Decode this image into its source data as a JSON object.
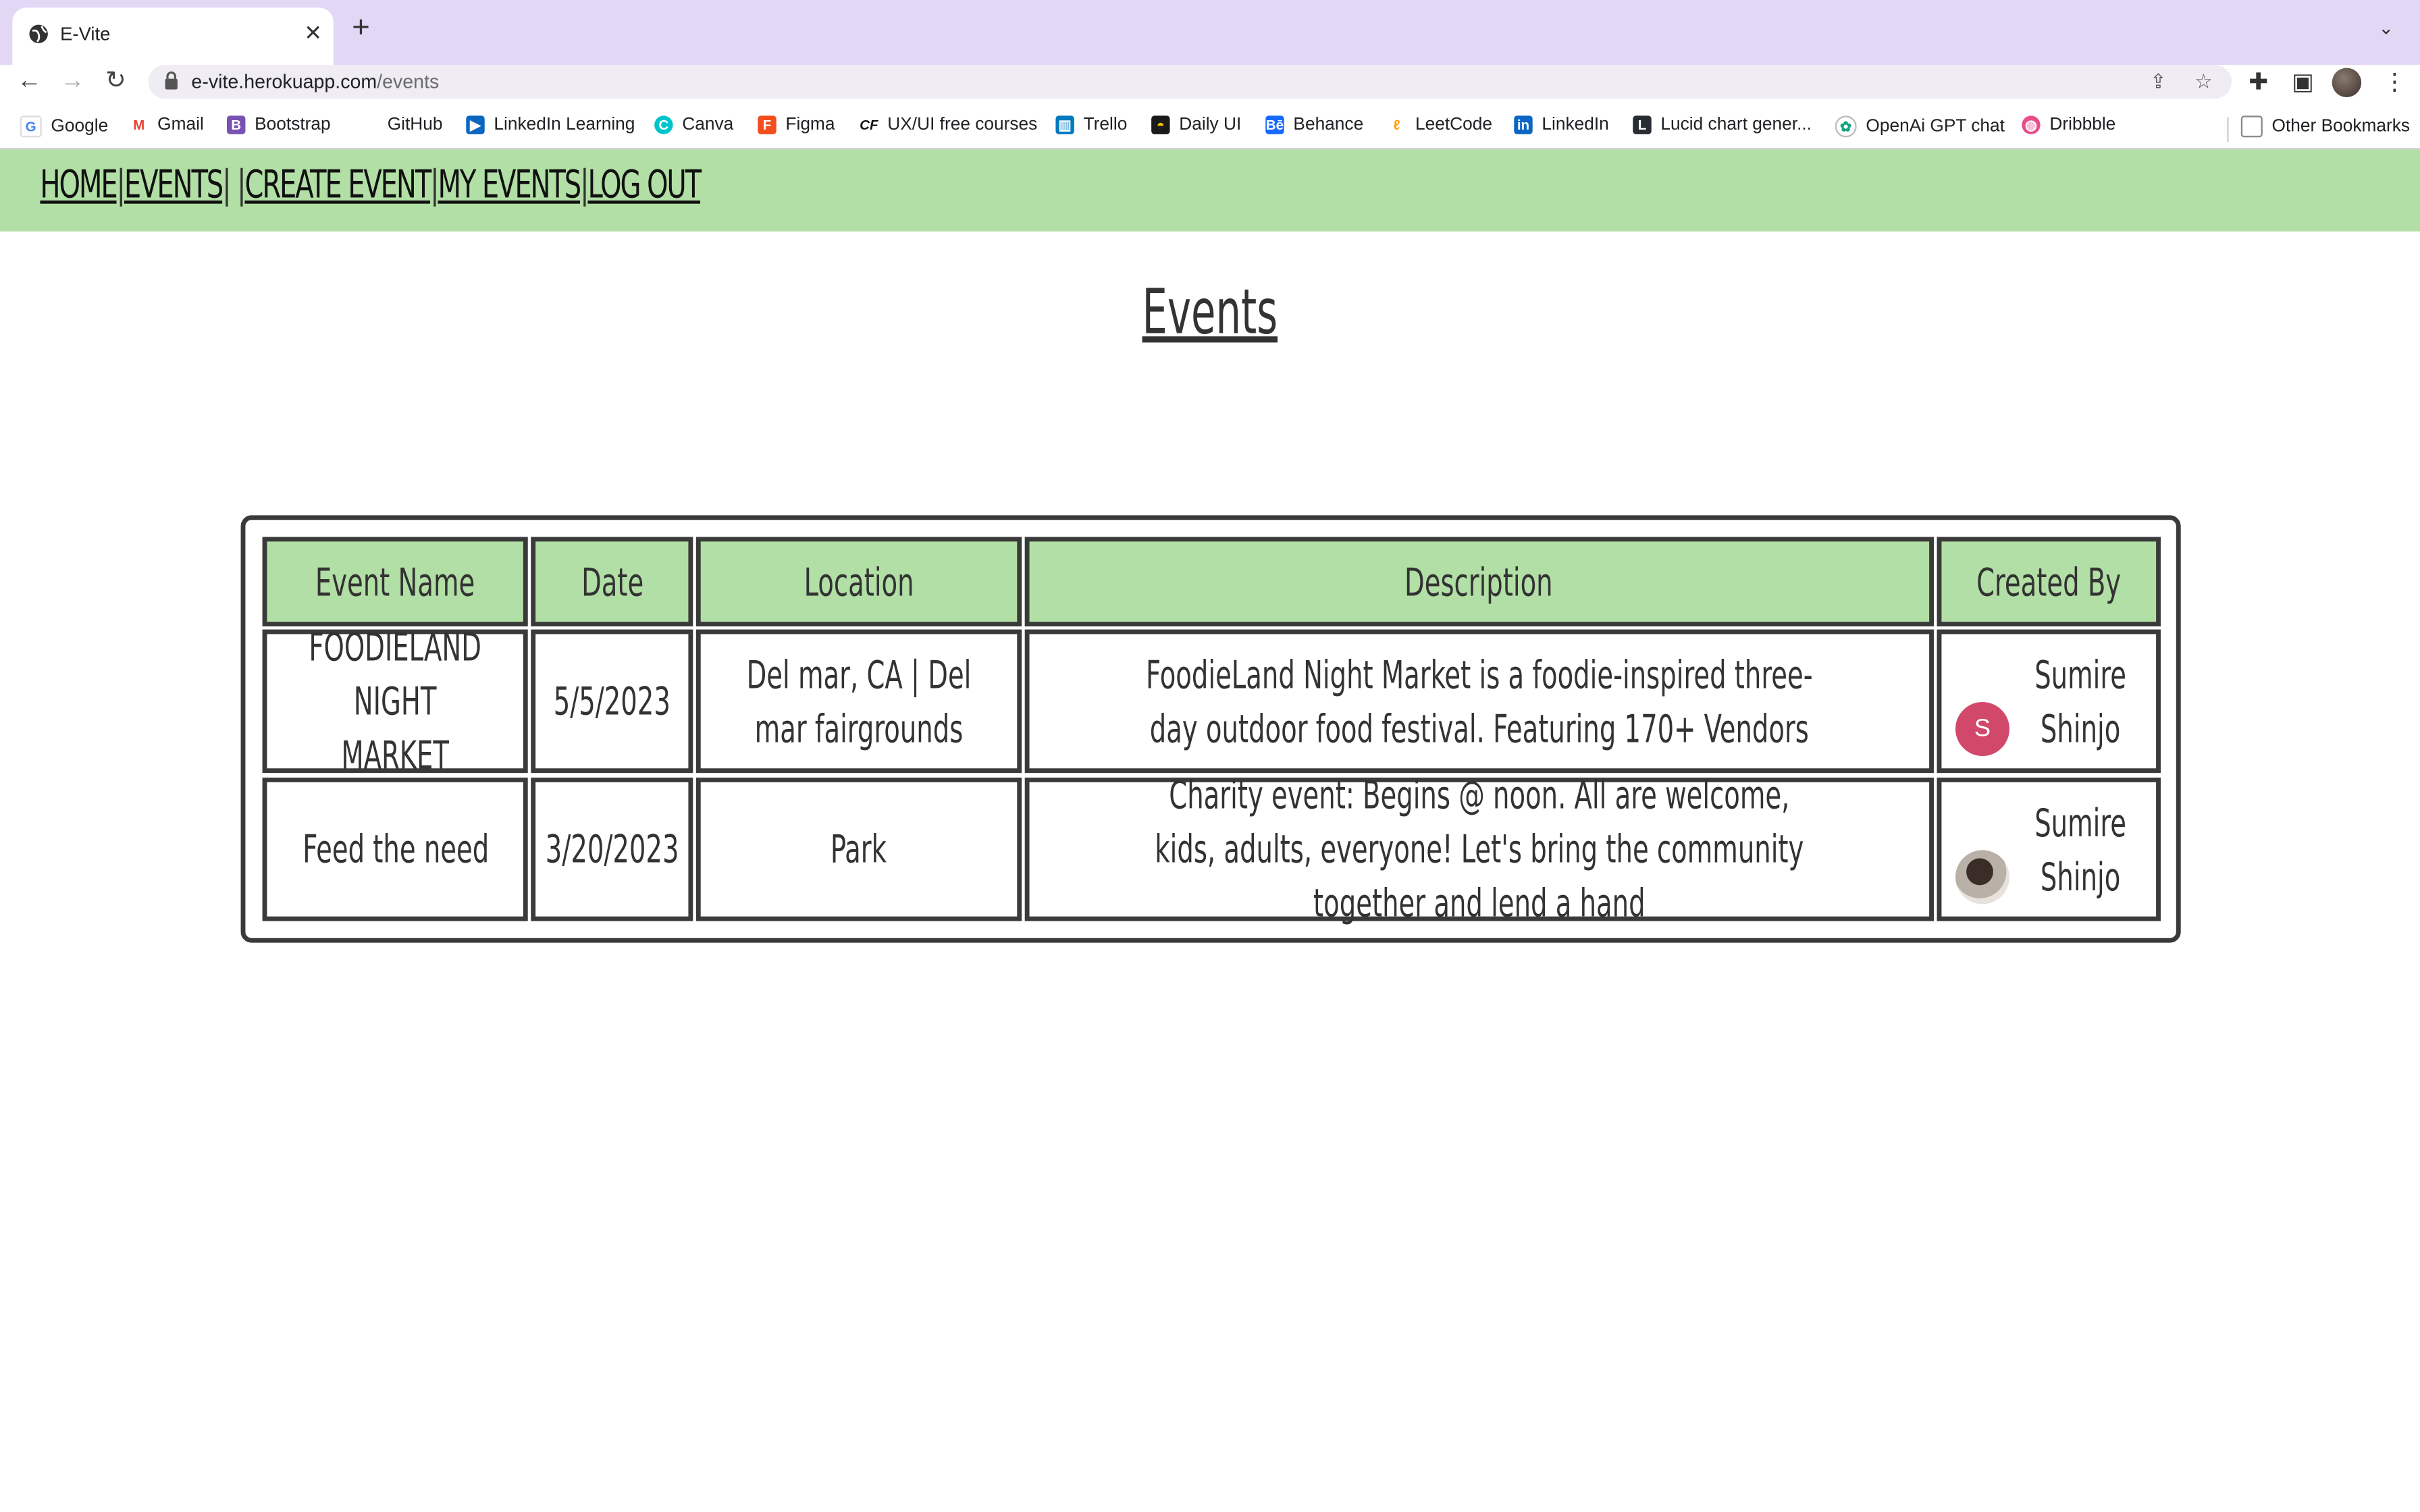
{
  "browser": {
    "tab_title": "E-Vite",
    "new_tab_label": "+",
    "url_host": "e-vite.herokuapp.com",
    "url_path": "/events",
    "bookmarks": [
      {
        "label": "Google",
        "icon": "google-icon",
        "color": "#4285f4"
      },
      {
        "label": "Gmail",
        "icon": "gmail-icon",
        "color": "#ea4335"
      },
      {
        "label": "Bootstrap",
        "icon": "bootstrap-icon",
        "color": "#7952b3"
      },
      {
        "label": "GitHub",
        "icon": "github-icon",
        "color": "#ffffff"
      },
      {
        "label": "LinkedIn Learning",
        "icon": "linkedin-learning-icon",
        "color": "#0a66c2"
      },
      {
        "label": "Canva",
        "icon": "canva-icon",
        "color": "#00c4cc"
      },
      {
        "label": "Figma",
        "icon": "figma-icon",
        "color": "#f24e1e"
      },
      {
        "label": "UX/UI free courses",
        "icon": "cf-icon",
        "color": "#111111"
      },
      {
        "label": "Trello",
        "icon": "trello-icon",
        "color": "#0079bf"
      },
      {
        "label": "Daily UI",
        "icon": "daily-ui-icon",
        "color": "#1a1a1a"
      },
      {
        "label": "Behance",
        "icon": "behance-icon",
        "color": "#1769ff"
      },
      {
        "label": "LeetCode",
        "icon": "leetcode-icon",
        "color": "#ffa116"
      },
      {
        "label": "LinkedIn",
        "icon": "linkedin-icon",
        "color": "#0a66c2"
      },
      {
        "label": "Lucid chart gener...",
        "icon": "lucid-icon",
        "color": "#282c33"
      },
      {
        "label": "OpenAi GPT chat",
        "icon": "openai-icon",
        "color": "#10a37f"
      },
      {
        "label": "Dribbble",
        "icon": "dribbble-icon",
        "color": "#ea4c89"
      }
    ],
    "other_bookmarks": "Other Bookmarks"
  },
  "nav": {
    "home": "HOME",
    "events": "EVENTS",
    "create_event": "CREATE EVENT",
    "my_events": "MY EVENTS",
    "log_out": "LOG OUT",
    "sep": "|",
    "sep_events": "| |"
  },
  "page": {
    "title": "Events",
    "accent_color": "#b2dfa5"
  },
  "table": {
    "headers": {
      "name": "Event Name",
      "date": "Date",
      "location": "Location",
      "description": "Description",
      "created_by": "Created By"
    },
    "rows": [
      {
        "name": "FOODIELAND NIGHT MARKET",
        "date": "5/5/2023",
        "location": "Del mar, CA | Del mar fairgrounds",
        "description": "FoodieLand Night Market is a foodie-inspired three-day outdoor food festival. Featuring 170+ Vendors",
        "created_by": "Sumire Shinjo",
        "avatar_initial": "S",
        "avatar_color": "#d2486a"
      },
      {
        "name": "Feed the need",
        "date": "3/20/2023",
        "location": "Park",
        "description": "Charity event: Begins @ noon. All are welcome, kids, adults, everyone! Let's bring the community together and lend a hand",
        "created_by": "Sumire Shinjo"
      }
    ]
  }
}
